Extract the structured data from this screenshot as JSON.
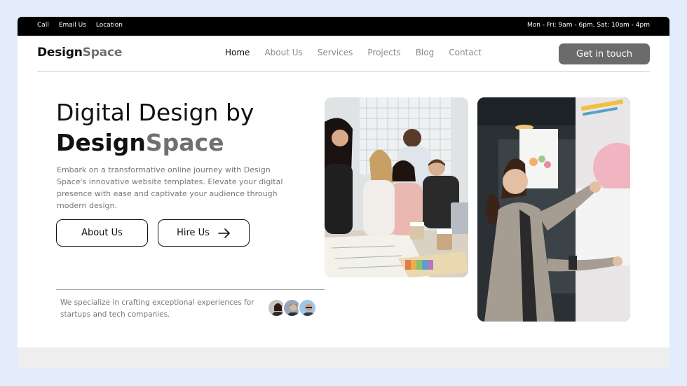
{
  "topbar": {
    "links": [
      "Call",
      "Email Us",
      "Location"
    ],
    "hours": "Mon - Fri: 9am - 6pm, Sat: 10am - 4pm"
  },
  "nav": {
    "logo_main": "Design",
    "logo_accent": "Space",
    "items": [
      "Home",
      "About Us",
      "Services",
      "Projects",
      "Blog",
      "Contact"
    ],
    "active": "Home",
    "cta": "Get in touch"
  },
  "hero": {
    "title_line1": "Digital Design by",
    "title_brand_main": "Design",
    "title_brand_accent": "Space",
    "description": "Embark on a transformative online journey with Design Space's innovative website templates. Elevate your digital presence with ease and captivate your audience through modern design.",
    "about_button": "About Us",
    "hire_button": "Hire Us"
  },
  "footer_note": {
    "tagline": "We specialize in crafting exceptional experiences for startups and tech companies."
  },
  "colors": {
    "topbar": "#000000",
    "accent_gray": "#707070",
    "cta_bg": "#6b6b6b",
    "page_bg": "#e3ecfb"
  }
}
